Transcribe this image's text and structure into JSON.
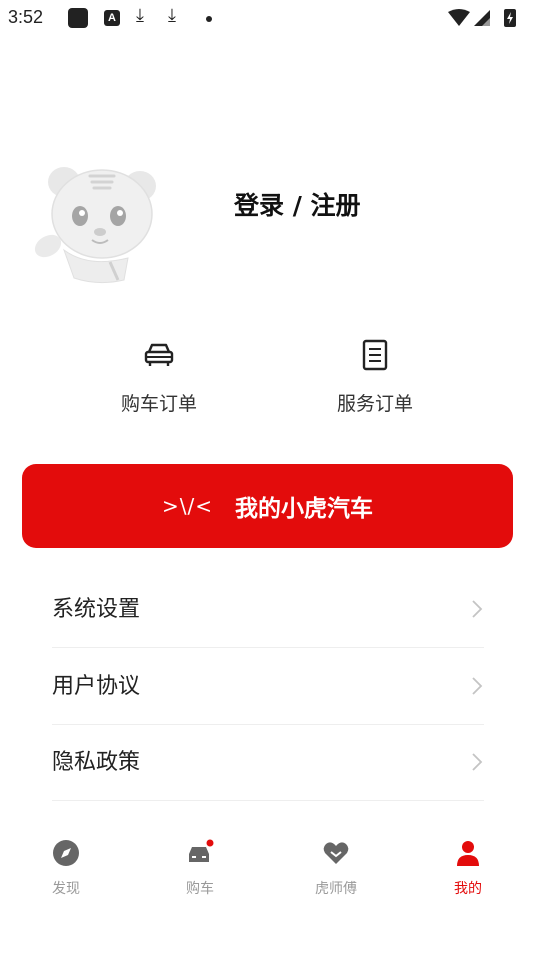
{
  "status_bar": {
    "time": "3:52",
    "a_badge": "A",
    "download_glyph": "⤓"
  },
  "profile": {
    "login_label": "登录 / 注册"
  },
  "orders": [
    {
      "label": "购车订单",
      "icon": "car-icon"
    },
    {
      "label": "服务订单",
      "icon": "document-icon"
    }
  ],
  "banner": {
    "logo": ">\\/<",
    "title": "我的小虎汽车",
    "color": "#e30c0c"
  },
  "menu": [
    {
      "label": "系统设置"
    },
    {
      "label": "用户协议"
    },
    {
      "label": "隐私政策"
    }
  ],
  "tabbar": {
    "active_color": "#e30c0c",
    "items": [
      {
        "label": "发现",
        "icon": "compass-icon"
      },
      {
        "label": "购车",
        "icon": "car-icon"
      },
      {
        "label": "虎师傅",
        "icon": "heart-icon"
      },
      {
        "label": "我的",
        "icon": "person-icon",
        "active": true
      }
    ]
  }
}
